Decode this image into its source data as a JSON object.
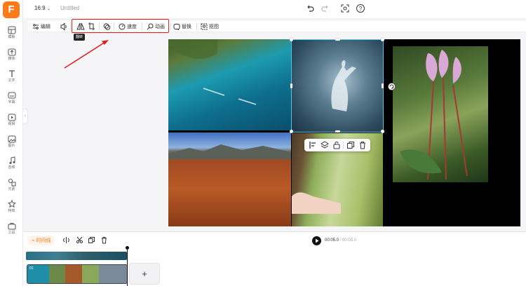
{
  "app": {
    "logo": "F",
    "doc_title": "Untitled",
    "aspect_ratio": "16:9"
  },
  "sidebar": {
    "items": [
      {
        "label": "模板",
        "icon": "layout-icon"
      },
      {
        "label": "媒体",
        "icon": "upload-icon"
      },
      {
        "label": "文字",
        "icon": "text-icon"
      },
      {
        "label": "字幕",
        "icon": "subtitle-icon"
      },
      {
        "label": "视频",
        "icon": "video-icon"
      },
      {
        "label": "图片",
        "icon": "image-icon"
      },
      {
        "label": "音频",
        "icon": "music-icon"
      },
      {
        "label": "元素",
        "icon": "elements-icon"
      },
      {
        "label": "特效",
        "icon": "effects-icon"
      },
      {
        "label": "工具",
        "icon": "toolbox-icon"
      }
    ]
  },
  "toolbar": {
    "edit_label": "编辑",
    "speed_label": "速度",
    "animation_label": "动画",
    "replace_label": "替换",
    "cutout_label": "抠图",
    "flip_tooltip": "翻转"
  },
  "timeline": {
    "label": "时间线",
    "current_time": "00:05.0",
    "separator": "/",
    "total_time": "00:05.0",
    "clip_index": "01",
    "add_label": "+"
  },
  "colors": {
    "accent": "#ff7a1a",
    "highlight": "#e02020",
    "selection": "#4fc6e0"
  }
}
